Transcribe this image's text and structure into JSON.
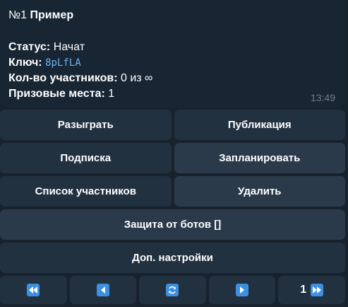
{
  "message": {
    "number": "№1",
    "name": "Пример",
    "status_label": "Статус:",
    "status_value": "Начат",
    "key_label": "Ключ:",
    "key_value": "8pLfLA",
    "participants_label": "Кол-во участников:",
    "participants_value": "0 из ∞",
    "prizes_label": "Призовые места:",
    "prizes_value": "1",
    "time": "13:49"
  },
  "keyboard": {
    "draw": "Разыграть",
    "publication": "Публикация",
    "subscription": "Подписка",
    "schedule": "Запланировать",
    "participants_list": "Список участников",
    "delete": "Удалить",
    "bot_protection": "Защита от ботов []",
    "extra_settings": "Доп. настройки",
    "page": "1"
  },
  "icons": {
    "first": "rewind-icon",
    "prev": "play-left-icon",
    "refresh": "refresh-icon",
    "next": "play-right-icon",
    "last": "fast-forward-icon"
  },
  "colors": {
    "accent": "#3d8fe0",
    "link": "#6ab3f3"
  }
}
